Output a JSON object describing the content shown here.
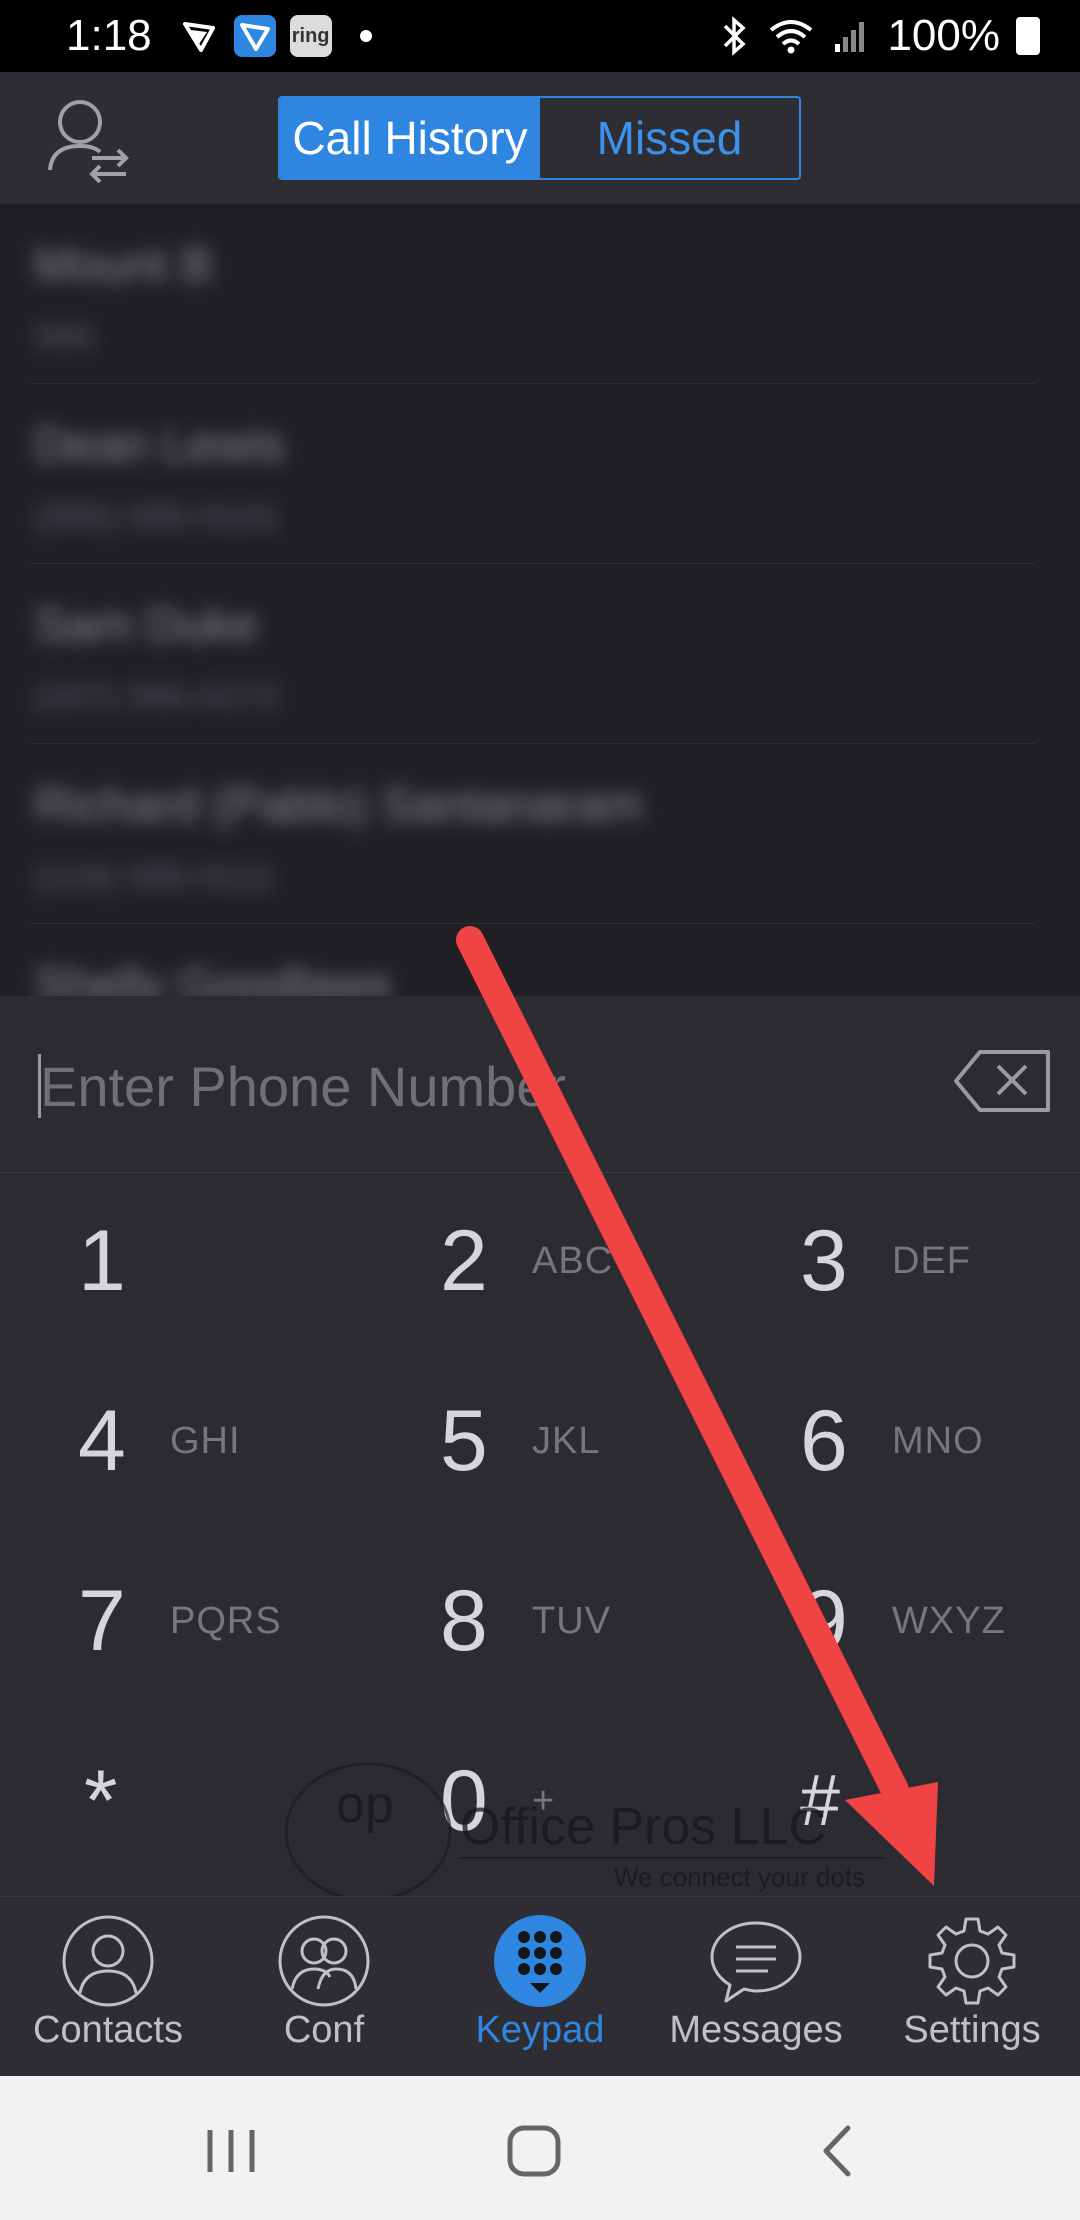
{
  "status_bar": {
    "time": "1:18",
    "app_icons": [
      "vpn-app-icon",
      "messenger-app-icon",
      "ring-app-icon"
    ],
    "ring_label": "ring",
    "battery": "100%"
  },
  "header": {
    "tabs": [
      {
        "label": "Call History",
        "active": true
      },
      {
        "label": "Missed",
        "active": false
      }
    ]
  },
  "history": {
    "blurred": true,
    "entries": [
      {
        "name": "Mount B",
        "number": "555"
      },
      {
        "name": "Dean Lewis",
        "number": "(555) 555-0101"
      },
      {
        "name": "Sam Duke",
        "number": "(207) 555-0172"
      },
      {
        "name": "Richard (Pablo) Santanaram",
        "number": "(216) 555-0111"
      },
      {
        "name": "Shelly Goodlaws",
        "number": ""
      }
    ]
  },
  "dialer": {
    "placeholder": "Enter Phone Number",
    "keys": [
      {
        "digit": "1",
        "letters": ""
      },
      {
        "digit": "2",
        "letters": "ABC"
      },
      {
        "digit": "3",
        "letters": "DEF"
      },
      {
        "digit": "4",
        "letters": "GHI"
      },
      {
        "digit": "5",
        "letters": "JKL"
      },
      {
        "digit": "6",
        "letters": "MNO"
      },
      {
        "digit": "7",
        "letters": "PQRS"
      },
      {
        "digit": "8",
        "letters": "TUV"
      },
      {
        "digit": "9",
        "letters": "WXYZ"
      },
      {
        "digit": "*",
        "letters": ""
      },
      {
        "digit": "0",
        "letters": "+"
      },
      {
        "digit": "#",
        "letters": ""
      }
    ]
  },
  "watermark": {
    "logo_text": "op",
    "company": "Office Pros LLC",
    "tagline": "We connect your dots"
  },
  "annotation": {
    "color": "#f04444"
  },
  "bottom_nav": {
    "items": [
      {
        "label": "Contacts",
        "icon": "contacts-icon",
        "active": false
      },
      {
        "label": "Conf",
        "icon": "conference-icon",
        "active": false
      },
      {
        "label": "Keypad",
        "icon": "keypad-icon",
        "active": true
      },
      {
        "label": "Messages",
        "icon": "messages-icon",
        "active": false
      },
      {
        "label": "Settings",
        "icon": "settings-gear-icon",
        "active": false
      }
    ]
  },
  "colors": {
    "accent": "#2f86e0",
    "background": "#2b2b31"
  }
}
